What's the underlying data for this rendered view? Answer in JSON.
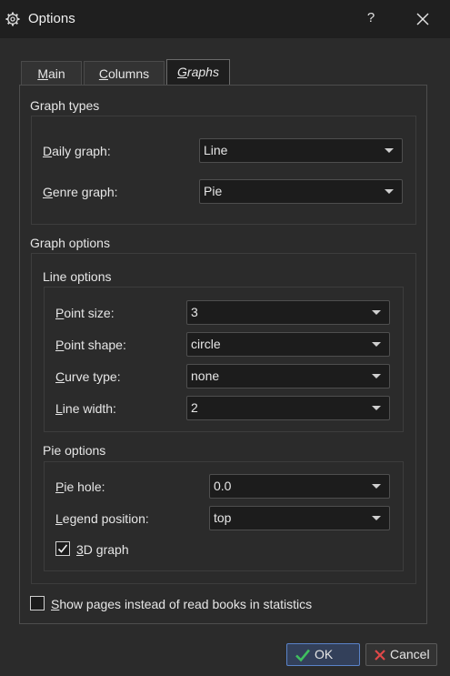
{
  "window": {
    "title": "Options",
    "help_label": "?"
  },
  "tabs": [
    {
      "prefix": "",
      "mnemonic": "M",
      "suffix": "ain"
    },
    {
      "prefix": "",
      "mnemonic": "C",
      "suffix": "olumns"
    },
    {
      "prefix": "",
      "mnemonic": "G",
      "suffix": "raphs",
      "active": true
    }
  ],
  "graph_types": {
    "title": "Graph types",
    "daily": {
      "mnemonic": "D",
      "rest": "aily graph:",
      "value": "Line"
    },
    "genre": {
      "mnemonic": "G",
      "rest": "enre graph:",
      "value": "Pie"
    }
  },
  "graph_options": {
    "title": "Graph options",
    "line_options": {
      "title": "Line options",
      "point_size": {
        "mnemonic": "P",
        "rest": "oint size:",
        "value": "3"
      },
      "point_shape": {
        "mnemonic": "P",
        "rest": "oint shape:",
        "value": "circle"
      },
      "curve_type": {
        "mnemonic": "C",
        "rest": "urve type:",
        "value": "none"
      },
      "line_width": {
        "mnemonic": "L",
        "rest": "ine width:",
        "value": "2"
      }
    },
    "pie_options": {
      "title": "Pie options",
      "pie_hole": {
        "mnemonic": "P",
        "rest": "ie hole:",
        "value": "0.0"
      },
      "legend_position": {
        "mnemonic": "L",
        "rest": "egend position:",
        "value": "top"
      },
      "graph_3d": {
        "mnemonic": "3",
        "rest": "D graph",
        "checked": true
      }
    }
  },
  "show_pages": {
    "mnemonic": "S",
    "rest": "how pages instead of read books in statistics",
    "checked": false
  },
  "buttons": {
    "ok": "OK",
    "cancel": "Cancel"
  },
  "colors": {
    "ok_check": "#3fbf5f",
    "cancel_x": "#e04848",
    "accent": "#5a82c8"
  }
}
